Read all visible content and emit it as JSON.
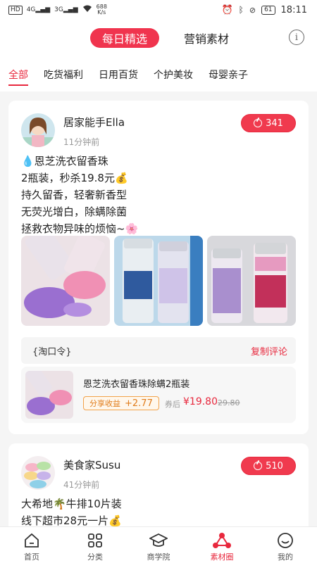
{
  "status_bar": {
    "left_chip": "HD",
    "signal_label": "4G",
    "signal2_label": "3G",
    "speed_value": "688",
    "speed_unit": "K/s",
    "battery": "61",
    "time": "18:11"
  },
  "header": {
    "segment_active": "每日精选",
    "segment_inactive": "营销素材",
    "info_icon": "i"
  },
  "categories": [
    "全部",
    "吃货福利",
    "日用百货",
    "个护美妆",
    "母婴亲子"
  ],
  "posts": [
    {
      "author": "居家能手Ella",
      "time": "11分钟前",
      "share_count": "341",
      "text_lines": [
        "💧恩芝洗衣留香珠",
        "2瓶装，秒杀19.8元💰",
        "持久留香，轻奢新香型",
        "无荧光增白，除螨除菌",
        "拯救衣物异味的烦恼~🌸"
      ],
      "tkl_label": "{淘口令}",
      "copy_label": "复制评论",
      "product": {
        "title": "恩芝洗衣留香珠除螨2瓶装",
        "earn_label": "分享收益",
        "earn_amount": "+2.77",
        "coupon_label": "券后",
        "price": "¥19.80",
        "original_price": "29.80"
      }
    },
    {
      "author": "美食家Susu",
      "time": "41分钟前",
      "share_count": "510",
      "text_lines": [
        "大希地🌴牛排10片装",
        "线下超市28元一片💰"
      ]
    }
  ],
  "tabbar": [
    {
      "label": "首页",
      "icon": "home-icon"
    },
    {
      "label": "分类",
      "icon": "grid-icon"
    },
    {
      "label": "商学院",
      "icon": "graduation-cap-icon"
    },
    {
      "label": "素材圈",
      "icon": "share-circle-icon"
    },
    {
      "label": "我的",
      "icon": "smiley-icon"
    }
  ],
  "colors": {
    "accent": "#e8283d",
    "earn": "#e07c1a"
  }
}
